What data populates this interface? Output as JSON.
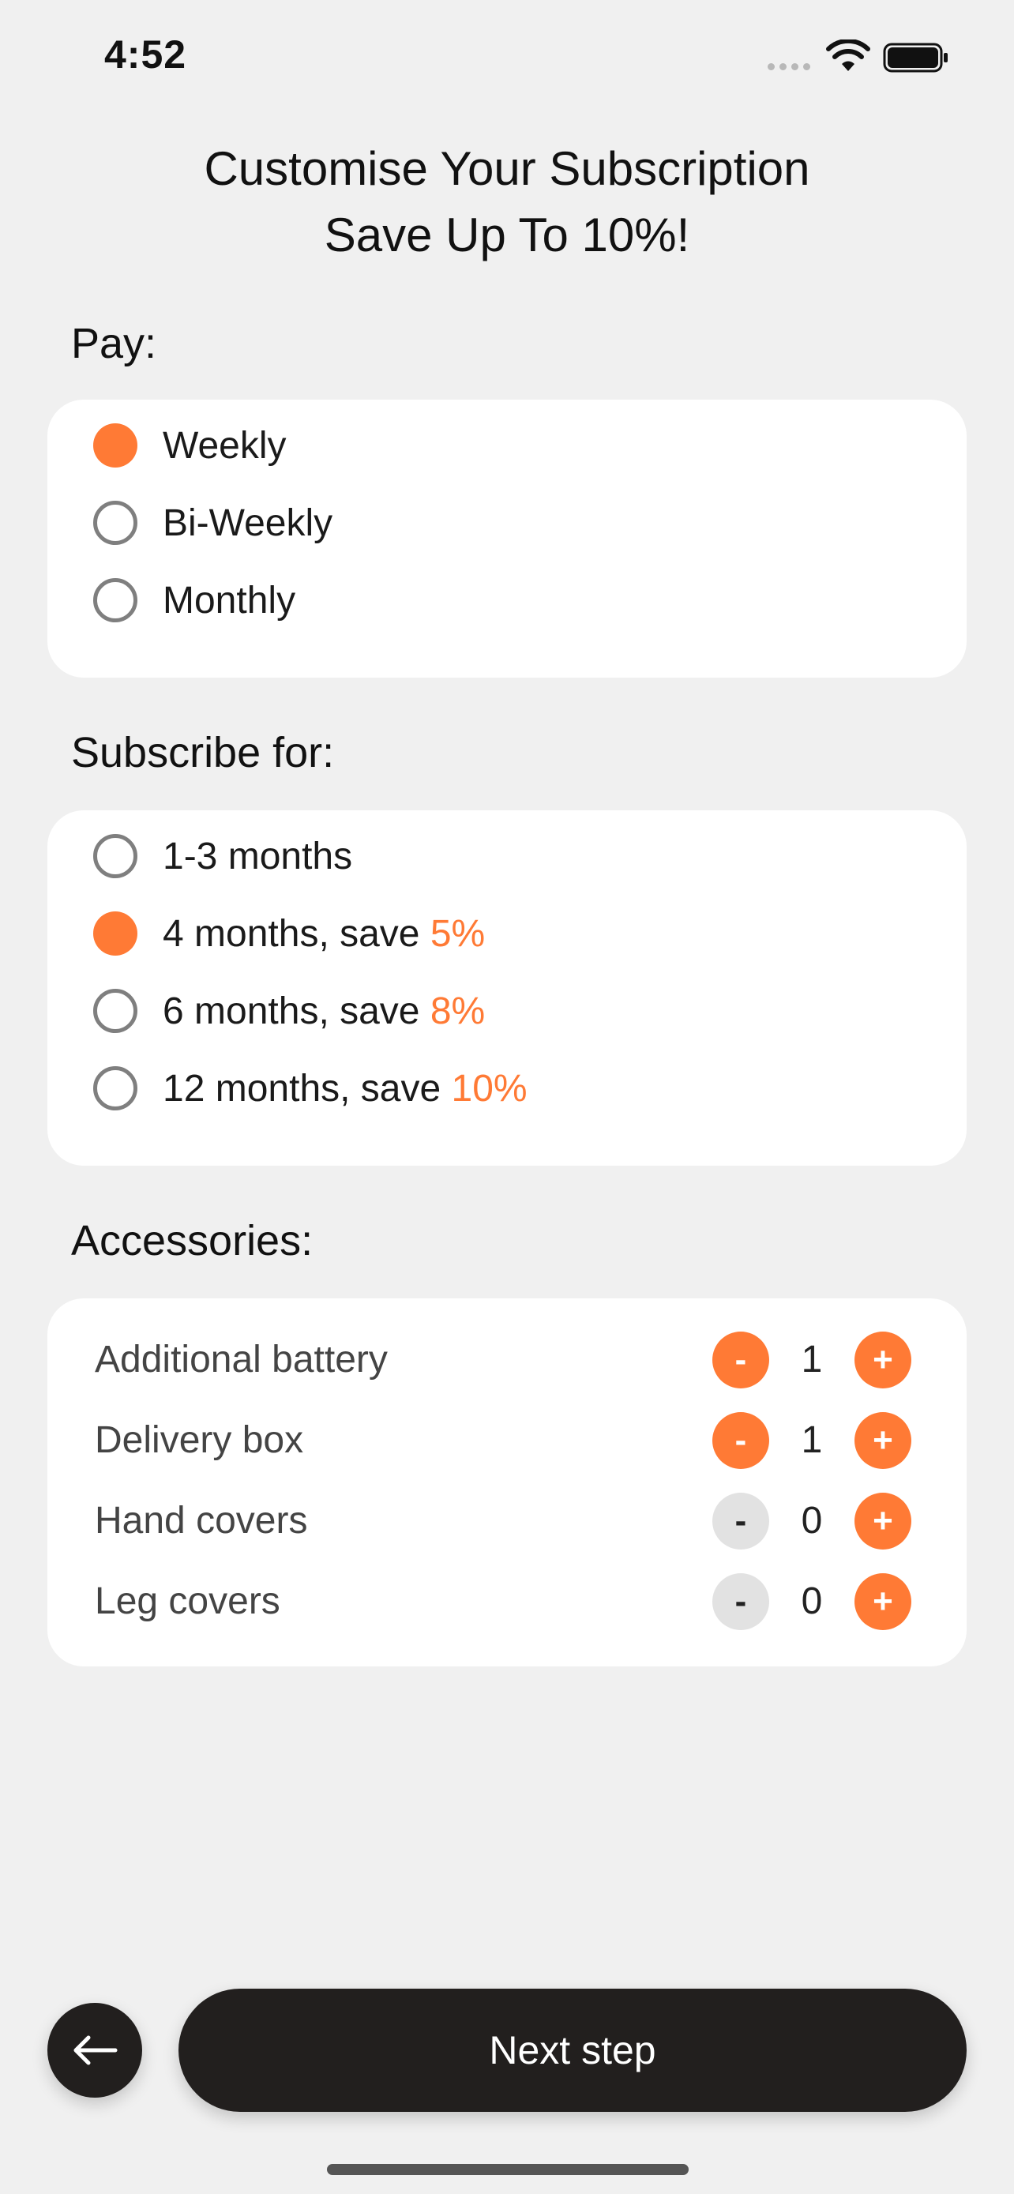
{
  "status_bar": {
    "time": "4:52"
  },
  "header": {
    "title_line1": "Customise Your Subscription",
    "title_line2": "Save Up To 10%!"
  },
  "pay": {
    "label": "Pay:",
    "options": [
      {
        "label": "Weekly",
        "selected": true
      },
      {
        "label": "Bi-Weekly",
        "selected": false
      },
      {
        "label": "Monthly",
        "selected": false
      }
    ]
  },
  "subscribe": {
    "label": "Subscribe for:",
    "options": [
      {
        "label": "1-3 months",
        "save": "",
        "selected": false
      },
      {
        "label": "4 months, save ",
        "save": "5%",
        "selected": true
      },
      {
        "label": "6 months, save ",
        "save": "8%",
        "selected": false
      },
      {
        "label": "12 months, save ",
        "save": "10%",
        "selected": false
      }
    ]
  },
  "accessories": {
    "label": "Accessories:",
    "items": [
      {
        "name": "Additional battery",
        "qty": "1",
        "minus": "-",
        "plus": "+"
      },
      {
        "name": "Delivery box",
        "qty": "1",
        "minus": "-",
        "plus": "+"
      },
      {
        "name": "Hand covers",
        "qty": "0",
        "minus": "-",
        "plus": "+"
      },
      {
        "name": "Leg covers",
        "qty": "0",
        "minus": "-",
        "plus": "+"
      }
    ]
  },
  "footer": {
    "next_label": "Next step",
    "back_icon": "arrow-left-icon"
  },
  "colors": {
    "accent": "#ff7a35",
    "dark": "#221f1e",
    "background": "#f0f0f0",
    "card": "#ffffff"
  }
}
